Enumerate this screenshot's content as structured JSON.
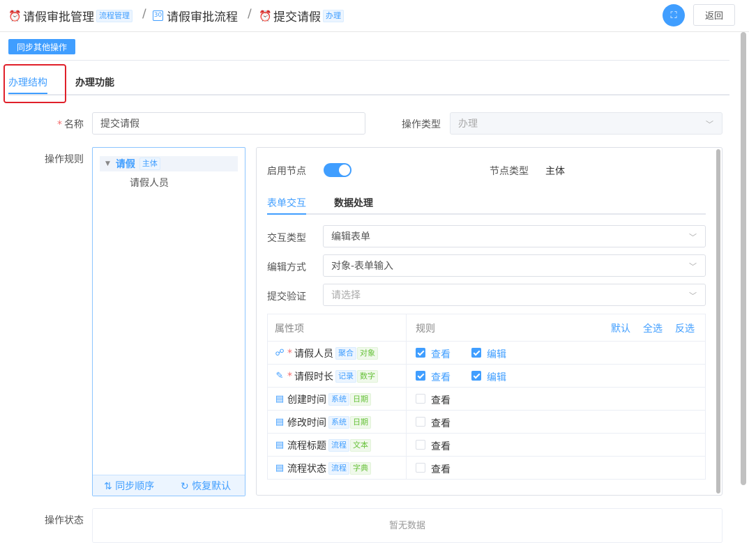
{
  "breadcrumb": [
    {
      "icon": "alarm-clock-icon",
      "label": "请假审批管理",
      "tag": "流程管理"
    },
    {
      "icon": "calendar-icon",
      "label": "请假审批流程",
      "calendar_day": "30"
    },
    {
      "icon": "alarm-clock-icon",
      "label": "提交请假",
      "tag": "办理"
    }
  ],
  "breadcrumb_separator": "/",
  "header": {
    "fullscreen_icon": "fullscreen-icon",
    "back_label": "返回"
  },
  "sync_button_label": "同步其他操作",
  "main_tabs": [
    {
      "label": "办理结构",
      "active": true
    },
    {
      "label": "办理功能",
      "active": false
    }
  ],
  "form": {
    "name_label": "名称",
    "name_value": "提交请假",
    "op_type_label": "操作类型",
    "op_type_value": "办理",
    "rules_label": "操作规则",
    "status_label": "操作状态",
    "status_empty": "暂无数据"
  },
  "tree": {
    "root_label": "请假",
    "root_tag": "主体",
    "children": [
      "请假人员"
    ],
    "footer_sync": "同步顺序",
    "footer_reset": "恢复默认"
  },
  "node": {
    "enable_label": "启用节点",
    "enabled": true,
    "type_label": "节点类型",
    "type_value": "主体"
  },
  "sub_tabs": [
    {
      "label": "表单交互",
      "active": true
    },
    {
      "label": "数据处理",
      "active": false
    }
  ],
  "selects": [
    {
      "label": "交互类型",
      "value": "编辑表单",
      "placeholder": ""
    },
    {
      "label": "编辑方式",
      "value": "对象-表单输入",
      "placeholder": ""
    },
    {
      "label": "提交验证",
      "value": "",
      "placeholder": "请选择"
    }
  ],
  "table": {
    "col_prop": "属性项",
    "col_rule": "规则",
    "actions": [
      "默认",
      "全选",
      "反选"
    ],
    "view_label": "查看",
    "edit_label": "编辑",
    "rows": [
      {
        "icon": "link-icon",
        "required": true,
        "name": "请假人员",
        "tags": [
          "聚合",
          "对象"
        ],
        "view": true,
        "edit": true,
        "has_edit": true
      },
      {
        "icon": "pencil-icon",
        "required": true,
        "name": "请假时长",
        "tags": [
          "记录",
          "数字"
        ],
        "view": true,
        "edit": true,
        "has_edit": true
      },
      {
        "icon": "document-icon",
        "required": false,
        "name": "创建时间",
        "tags": [
          "系统",
          "日期"
        ],
        "view": false,
        "has_edit": false
      },
      {
        "icon": "document-icon",
        "required": false,
        "name": "修改时间",
        "tags": [
          "系统",
          "日期"
        ],
        "view": false,
        "has_edit": false
      },
      {
        "icon": "document-icon",
        "required": false,
        "name": "流程标题",
        "tags": [
          "流程",
          "文本"
        ],
        "view": false,
        "has_edit": false
      },
      {
        "icon": "document-icon",
        "required": false,
        "name": "流程状态",
        "tags": [
          "流程",
          "字典"
        ],
        "view": false,
        "has_edit": false
      }
    ]
  },
  "colors": {
    "primary": "#409eff",
    "highlight_box": "#e0202a",
    "tag_green": "#67c23a"
  }
}
